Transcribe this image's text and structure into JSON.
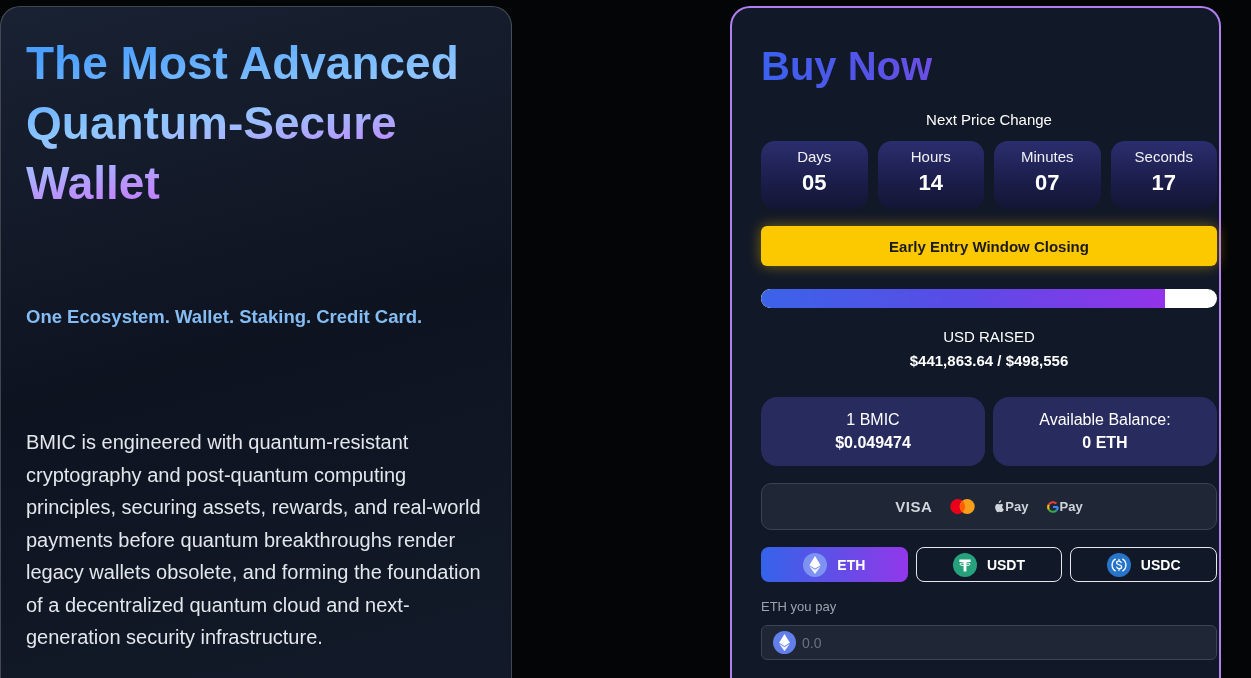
{
  "hero": {
    "title": "The Most Advanced Quantum-Secure Wallet",
    "tagline": "One Ecosystem. Wallet. Staking. Credit Card.",
    "description": "BMIC is engineered with quantum-resistant cryptography and post-quantum computing principles, securing assets, rewards, and real-world payments before quantum breakthroughs render legacy wallets obsolete, and forming the foundation of a decentralized quantum cloud and next-generation security infrastructure."
  },
  "buy_panel": {
    "title": "Buy Now",
    "countdown": {
      "label": "Next Price Change",
      "units": [
        {
          "label": "Days",
          "value": "05"
        },
        {
          "label": "Hours",
          "value": "14"
        },
        {
          "label": "Minutes",
          "value": "07"
        },
        {
          "label": "Seconds",
          "value": "17"
        }
      ]
    },
    "notice": "Early Entry Window Closing",
    "progress": {
      "level": 0.886,
      "label": "USD RAISED",
      "value": "$441,863.64 / $498,556"
    },
    "stats": [
      {
        "label": "1 BMIC",
        "value": "$0.049474"
      },
      {
        "label": "Available Balance:",
        "value": "0 ETH"
      }
    ],
    "payment_methods": [
      {
        "kind": "visa",
        "label": "VISA"
      },
      {
        "kind": "mastercard"
      },
      {
        "kind": "apple-pay",
        "label": "Pay"
      },
      {
        "kind": "google-pay",
        "label": "Pay"
      }
    ],
    "currencies": [
      {
        "kind": "eth",
        "label": "ETH",
        "selected": true
      },
      {
        "kind": "usdt",
        "label": "USDT",
        "selected": false
      },
      {
        "kind": "usdc",
        "label": "USDC",
        "selected": false
      }
    ],
    "amount": {
      "label": "ETH you pay",
      "placeholder": "0.0"
    }
  }
}
